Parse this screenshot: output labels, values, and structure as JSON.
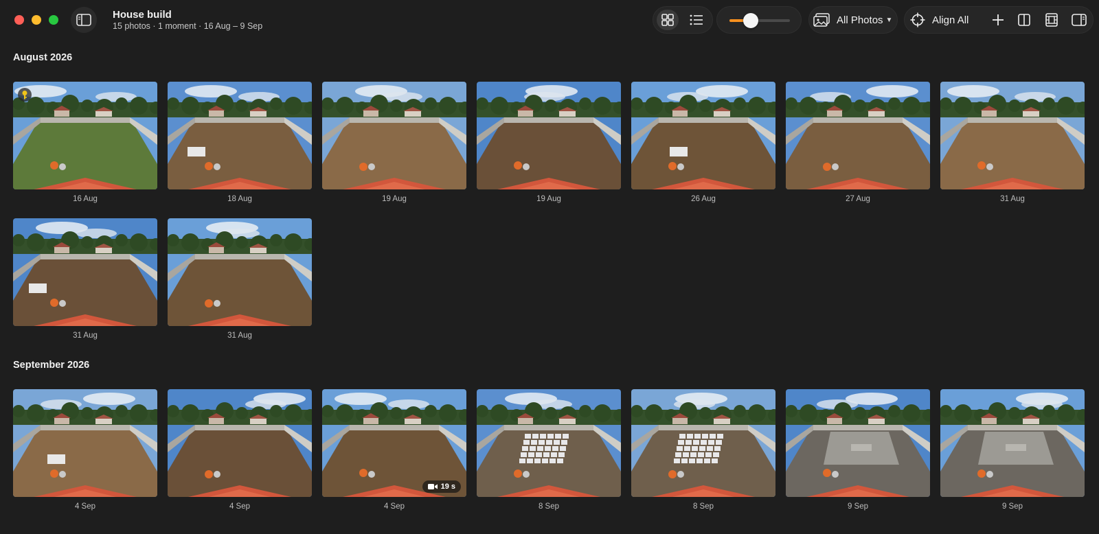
{
  "window": {
    "title": "House build",
    "subtitle": "15 photos · 1 moment · 16 Aug – 9 Sep"
  },
  "toolbar": {
    "view_modes": [
      "grid",
      "list"
    ],
    "selected_view": "grid",
    "zoom_level": 0.35,
    "filter_label": "All Photos",
    "align_label": "Align All"
  },
  "colors": {
    "accent": "#f7901e",
    "background": "#1e1e1e"
  },
  "icons": [
    "sidebar-icon",
    "grid-view-icon",
    "list-view-icon",
    "photos-filter-icon",
    "chevron-down-icon",
    "crosshair-icon",
    "plus-icon",
    "split-view-icon",
    "film-strip-icon",
    "inspector-icon",
    "key-photo-icon",
    "video-camera-icon"
  ],
  "sections": [
    {
      "title": "August 2026",
      "photos": [
        {
          "date": "16 Aug",
          "stage": "grass",
          "key_photo": true
        },
        {
          "date": "18 Aug",
          "stage": "dirt"
        },
        {
          "date": "19 Aug",
          "stage": "dirt"
        },
        {
          "date": "19 Aug",
          "stage": "dirt"
        },
        {
          "date": "26 Aug",
          "stage": "dirt"
        },
        {
          "date": "27 Aug",
          "stage": "dirt"
        },
        {
          "date": "31 Aug",
          "stage": "dirt"
        },
        {
          "date": "31 Aug",
          "stage": "dirt"
        },
        {
          "date": "31 Aug",
          "stage": "dirt"
        }
      ]
    },
    {
      "title": "September 2026",
      "photos": [
        {
          "date": "4 Sep",
          "stage": "dirt"
        },
        {
          "date": "4 Sep",
          "stage": "dirt"
        },
        {
          "date": "4 Sep",
          "stage": "dirt",
          "video_duration": "19 s"
        },
        {
          "date": "8 Sep",
          "stage": "forms"
        },
        {
          "date": "8 Sep",
          "stage": "forms"
        },
        {
          "date": "9 Sep",
          "stage": "slab"
        },
        {
          "date": "9 Sep",
          "stage": "slab"
        }
      ]
    }
  ]
}
